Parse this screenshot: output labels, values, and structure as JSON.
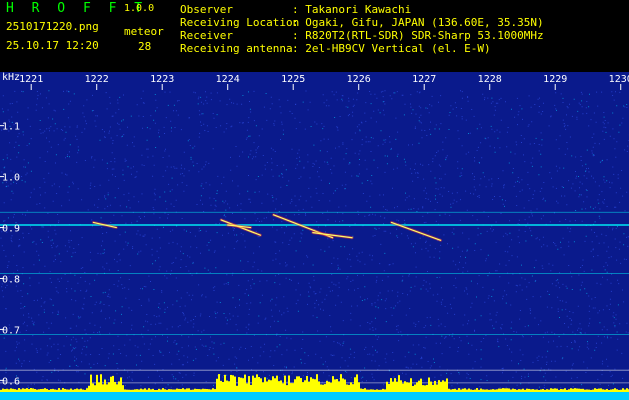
{
  "app": {
    "title": "H R O F F T",
    "version": "1.0.0",
    "file_name": "2510171220.png",
    "timestamp": "25.10.17 12:20",
    "meteor_label": "meteor",
    "meteor_count": "28"
  },
  "info": [
    {
      "key": "Observer",
      "value": ": Takanori Kawachi"
    },
    {
      "key": "Receiving Location",
      "value": ": Ogaki, Gifu, JAPAN (136.60E, 35.35N)"
    },
    {
      "key": "Receiver",
      "value": ": R820T2(RTL-SDR) SDR-Sharp 53.1000MHz"
    },
    {
      "key": "Receiving antenna",
      "value": ": 2el-HB9CV Vertical (el. E-W)"
    }
  ],
  "spectrogram": {
    "freq_unit": "kHz",
    "time_ticks": [
      "1221",
      "1222",
      "1223",
      "1224",
      "1225",
      "1226",
      "1227",
      "1228",
      "1229",
      "1230"
    ],
    "time_range": [
      1220.6,
      1230.05
    ],
    "freq_ticks": [
      "1.1",
      "1.0",
      "0.9",
      "0.8",
      "0.7",
      "0.6"
    ],
    "freq_range": [
      0.585,
      1.17
    ],
    "carrier_lines_khz": [
      0.93,
      0.905,
      0.81,
      0.69,
      0.62,
      0.595
    ],
    "meteor_echoes": [
      {
        "t": [
          1221.95,
          1222.3
        ],
        "f": [
          0.91,
          0.9
        ]
      },
      {
        "t": [
          1223.9,
          1224.5
        ],
        "f": [
          0.915,
          0.885
        ]
      },
      {
        "t": [
          1224.0,
          1224.35
        ],
        "f": [
          0.905,
          0.9
        ]
      },
      {
        "t": [
          1224.7,
          1225.6
        ],
        "f": [
          0.925,
          0.88
        ]
      },
      {
        "t": [
          1225.3,
          1225.9
        ],
        "f": [
          0.89,
          0.88
        ]
      },
      {
        "t": [
          1226.5,
          1227.25
        ],
        "f": [
          0.91,
          0.875
        ]
      }
    ],
    "colors": {
      "background": "#0a1a8c",
      "carrier": "#00ffff",
      "echo": "#ffff66",
      "activity": "#ffff00",
      "ground": "#00ccff",
      "tick_label": "#ffffff"
    }
  }
}
